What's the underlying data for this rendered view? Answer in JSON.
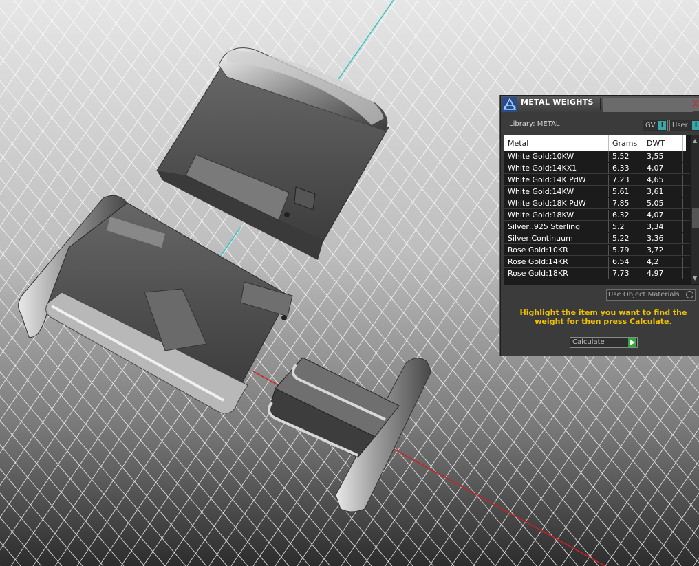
{
  "panel": {
    "title": "METAL WEIGHTS",
    "close_label": "X",
    "library_label": "Library: METAL",
    "toggles": {
      "gv_label": "GV",
      "user_label": "User",
      "indicator": "I"
    },
    "table": {
      "headers": {
        "metal": "Metal",
        "grams": "Grams",
        "dwt": "DWT"
      },
      "rows": [
        {
          "metal": "White Gold:10KW",
          "grams": "5.52",
          "dwt": "3,55"
        },
        {
          "metal": "White Gold:14KX1",
          "grams": "6.33",
          "dwt": "4,07"
        },
        {
          "metal": "White Gold:14K PdW",
          "grams": "7.23",
          "dwt": "4,65"
        },
        {
          "metal": "White Gold:14KW",
          "grams": "5.61",
          "dwt": "3,61"
        },
        {
          "metal": "White Gold:18K PdW",
          "grams": "7.85",
          "dwt": "5,05"
        },
        {
          "metal": "White Gold:18KW",
          "grams": "6.32",
          "dwt": "4,07"
        },
        {
          "metal": "Silver:.925 Sterling",
          "grams": "5.2",
          "dwt": "3,34"
        },
        {
          "metal": "Silver:Continuum",
          "grams": "5.22",
          "dwt": "3,36"
        },
        {
          "metal": "Rose Gold:10KR",
          "grams": "5.79",
          "dwt": "3,72"
        },
        {
          "metal": "Rose Gold:14KR",
          "grams": "6.54",
          "dwt": "4,2"
        },
        {
          "metal": "Rose Gold:18KR",
          "grams": "7.73",
          "dwt": "4,97"
        }
      ]
    },
    "use_object_materials_label": "Use Object Materials",
    "instructions": "Highlight the item you want to find the weight for then press Calculate.",
    "calculate_label": "Calculate",
    "colors": {
      "instruction_text": "#f2c200",
      "toggle_indicator": "#3aa6a6",
      "calculate_arrow": "#2faa3c",
      "panel_bg": "#3b3b3b"
    }
  },
  "viewport": {
    "axis_colors": {
      "y_axis": "#2ec4c4",
      "x_axis": "#d02020"
    },
    "background_gradient": [
      "#e4e4e4",
      "#2a2a2a"
    ]
  }
}
